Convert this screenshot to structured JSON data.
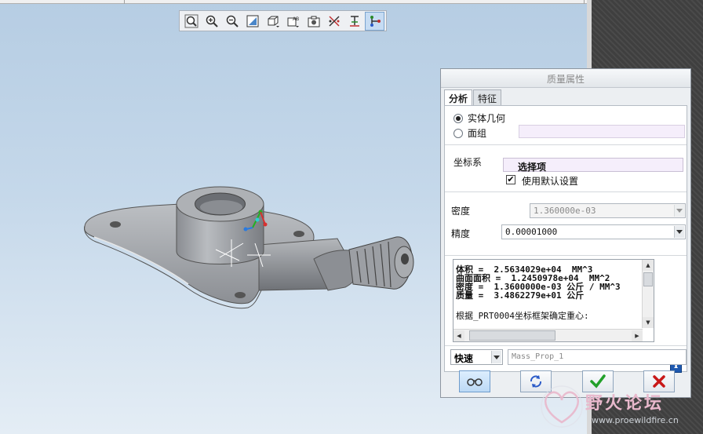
{
  "toolbar": {
    "buttons": [
      {
        "name": "zoom-fit-icon"
      },
      {
        "name": "zoom-in-icon"
      },
      {
        "name": "zoom-out-icon"
      },
      {
        "name": "repaint-icon"
      },
      {
        "name": "view-orient-icon"
      },
      {
        "name": "saved-views-icon"
      },
      {
        "name": "display-style-icon"
      },
      {
        "name": "datum-display-icon"
      },
      {
        "name": "csys-display-icon"
      },
      {
        "name": "spin-center-icon"
      }
    ],
    "saved_views_glyph": "AB"
  },
  "dialog": {
    "title": "质量属性",
    "tabs": [
      "分析",
      "特征"
    ],
    "geometry": {
      "solid_label": "实体几何",
      "quilt_label": "面组",
      "selected": "solid"
    },
    "csys": {
      "label": "坐标系",
      "select_value": "选择项",
      "use_default_label": "使用默认设置",
      "use_default_checked": true
    },
    "density": {
      "label": "密度",
      "value": "1.360000e-03"
    },
    "accuracy": {
      "label": "精度",
      "value": "0.00001000"
    },
    "results": {
      "line1": "体积 =  2.5634029e+04  MM^3",
      "line2": "曲面面积 =  1.2450978e+04  MM^2",
      "line3": "密度 =  1.3600000e-03 公斤 / MM^3",
      "line4": "质量 =  3.4862279e+01 公斤",
      "line5": "根据_PRT0004坐标框架确定重心:"
    },
    "mode": {
      "value": "快速"
    },
    "feature_name": {
      "value": "Mass_Prop_1"
    },
    "info_glyph": "i"
  },
  "watermark": {
    "text": "野火论坛",
    "url": "www.proewildfire.cn"
  },
  "colors": {
    "viewport_top": "#b6cde3",
    "viewport_bottom": "#e4edf5",
    "accent": "#6f9ccc",
    "ok_green": "#22a02a",
    "cancel_red": "#c81818"
  }
}
